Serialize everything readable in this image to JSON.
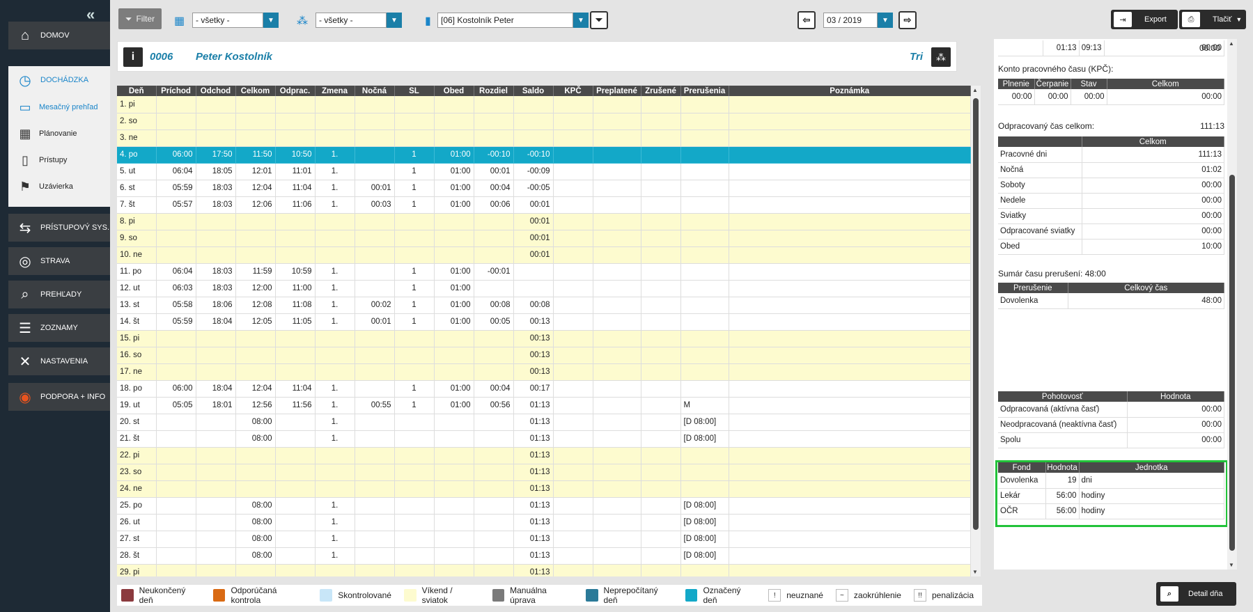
{
  "sidebar": {
    "items": [
      {
        "label": "DOMOV",
        "icon": "home-icon"
      },
      {
        "label": "DOCHÁDZKA",
        "icon": "clock-icon"
      },
      {
        "label": "PRÍSTUPOVÝ SYS.",
        "icon": "handshake-icon"
      },
      {
        "label": "STRAVA",
        "icon": "plate-icon"
      },
      {
        "label": "PREHĽADY",
        "icon": "book-search-icon"
      },
      {
        "label": "ZOZNAMY",
        "icon": "list-icon"
      },
      {
        "label": "NASTAVENIA",
        "icon": "tools-icon"
      },
      {
        "label": "PODPORA + INFO",
        "icon": "lifebuoy-icon"
      }
    ],
    "subitems": [
      {
        "label": "Mesačný prehľad",
        "icon": "book-icon"
      },
      {
        "label": "Plánovanie",
        "icon": "calendar-icon"
      },
      {
        "label": "Prístupy",
        "icon": "door-icon"
      },
      {
        "label": "Uzávierka",
        "icon": "flag-icon"
      }
    ]
  },
  "toolbar": {
    "filter_label": "Filter",
    "select1": "- všetky -",
    "select2": "- všetky -",
    "employee": "[06] Kostolník Peter",
    "month": "03 / 2019",
    "export_label": "Export",
    "print_label": "Tlačiť"
  },
  "header": {
    "id": "0006",
    "name": "Peter Kostolník",
    "shift": "Tri"
  },
  "table": {
    "columns": [
      "Deň",
      "Príchod",
      "Odchod",
      "Celkom",
      "Odprac.",
      "Zmena",
      "Nočná",
      "SL",
      "Obed",
      "Rozdiel",
      "Saldo",
      "KPČ",
      "Preplatené",
      "Zrušené",
      "Prerušenia",
      "Poznámka"
    ],
    "rows": [
      {
        "t": "wk",
        "c": [
          "1. pi",
          "",
          "",
          "",
          "",
          "",
          "",
          "",
          "",
          "",
          "",
          "",
          "",
          "",
          "",
          ""
        ]
      },
      {
        "t": "wk",
        "c": [
          "2. so",
          "",
          "",
          "",
          "",
          "",
          "",
          "",
          "",
          "",
          "",
          "",
          "",
          "",
          "",
          ""
        ]
      },
      {
        "t": "wk",
        "c": [
          "3. ne",
          "",
          "",
          "",
          "",
          "",
          "",
          "",
          "",
          "",
          "",
          "",
          "",
          "",
          "",
          ""
        ]
      },
      {
        "t": "hl",
        "c": [
          "4. po",
          "06:00",
          "17:50",
          "11:50",
          "10:50",
          "1.",
          "",
          "1",
          "01:00",
          "-00:10",
          "-00:10",
          "",
          "",
          "",
          "",
          ""
        ]
      },
      {
        "t": "n",
        "c": [
          "5. ut",
          "06:04",
          "18:05",
          "12:01",
          "11:01",
          "1.",
          "",
          "1",
          "01:00",
          "00:01",
          "-00:09",
          "",
          "",
          "",
          "",
          ""
        ]
      },
      {
        "t": "n",
        "c": [
          "6. st",
          "05:59",
          "18:03",
          "12:04",
          "11:04",
          "1.",
          "00:01",
          "1",
          "01:00",
          "00:04",
          "-00:05",
          "",
          "",
          "",
          "",
          ""
        ]
      },
      {
        "t": "n",
        "c": [
          "7. št",
          "05:57",
          "18:03",
          "12:06",
          "11:06",
          "1.",
          "00:03",
          "1",
          "01:00",
          "00:06",
          "00:01",
          "",
          "",
          "",
          "",
          ""
        ]
      },
      {
        "t": "wk",
        "c": [
          "8. pi",
          "",
          "",
          "",
          "",
          "",
          "",
          "",
          "",
          "",
          "00:01",
          "",
          "",
          "",
          "",
          ""
        ]
      },
      {
        "t": "wk",
        "c": [
          "9. so",
          "",
          "",
          "",
          "",
          "",
          "",
          "",
          "",
          "",
          "00:01",
          "",
          "",
          "",
          "",
          ""
        ]
      },
      {
        "t": "wk",
        "c": [
          "10. ne",
          "",
          "",
          "",
          "",
          "",
          "",
          "",
          "",
          "",
          "00:01",
          "",
          "",
          "",
          "",
          ""
        ]
      },
      {
        "t": "n",
        "c": [
          "11. po",
          "06:04",
          "18:03",
          "11:59",
          "10:59",
          "1.",
          "",
          "1",
          "01:00",
          "-00:01",
          "",
          "",
          "",
          "",
          "",
          ""
        ]
      },
      {
        "t": "n",
        "c": [
          "12. ut",
          "06:03",
          "18:03",
          "12:00",
          "11:00",
          "1.",
          "",
          "1",
          "01:00",
          "",
          "",
          "",
          "",
          "",
          "",
          ""
        ]
      },
      {
        "t": "n",
        "c": [
          "13. st",
          "05:58",
          "18:06",
          "12:08",
          "11:08",
          "1.",
          "00:02",
          "1",
          "01:00",
          "00:08",
          "00:08",
          "",
          "",
          "",
          "",
          ""
        ]
      },
      {
        "t": "n",
        "c": [
          "14. št",
          "05:59",
          "18:04",
          "12:05",
          "11:05",
          "1.",
          "00:01",
          "1",
          "01:00",
          "00:05",
          "00:13",
          "",
          "",
          "",
          "",
          ""
        ]
      },
      {
        "t": "wk",
        "c": [
          "15. pi",
          "",
          "",
          "",
          "",
          "",
          "",
          "",
          "",
          "",
          "00:13",
          "",
          "",
          "",
          "",
          ""
        ]
      },
      {
        "t": "wk",
        "c": [
          "16. so",
          "",
          "",
          "",
          "",
          "",
          "",
          "",
          "",
          "",
          "00:13",
          "",
          "",
          "",
          "",
          ""
        ]
      },
      {
        "t": "wk",
        "c": [
          "17. ne",
          "",
          "",
          "",
          "",
          "",
          "",
          "",
          "",
          "",
          "00:13",
          "",
          "",
          "",
          "",
          ""
        ]
      },
      {
        "t": "n",
        "c": [
          "18. po",
          "06:00",
          "18:04",
          "12:04",
          "11:04",
          "1.",
          "",
          "1",
          "01:00",
          "00:04",
          "00:17",
          "",
          "",
          "",
          "",
          ""
        ]
      },
      {
        "t": "n",
        "c": [
          "19. ut",
          "05:05",
          "18:01",
          "12:56",
          "11:56",
          "1.",
          "00:55",
          "1",
          "01:00",
          "00:56",
          "01:13",
          "",
          "",
          "",
          "M",
          ""
        ]
      },
      {
        "t": "n",
        "c": [
          "20. st",
          "",
          "",
          "08:00",
          "",
          "1.",
          "",
          "",
          "",
          "",
          "01:13",
          "",
          "",
          "",
          "[D 08:00]",
          ""
        ]
      },
      {
        "t": "n",
        "c": [
          "21. št",
          "",
          "",
          "08:00",
          "",
          "1.",
          "",
          "",
          "",
          "",
          "01:13",
          "",
          "",
          "",
          "[D 08:00]",
          ""
        ]
      },
      {
        "t": "wk",
        "c": [
          "22. pi",
          "",
          "",
          "",
          "",
          "",
          "",
          "",
          "",
          "",
          "01:13",
          "",
          "",
          "",
          "",
          ""
        ]
      },
      {
        "t": "wk",
        "c": [
          "23. so",
          "",
          "",
          "",
          "",
          "",
          "",
          "",
          "",
          "",
          "01:13",
          "",
          "",
          "",
          "",
          ""
        ]
      },
      {
        "t": "wk",
        "c": [
          "24. ne",
          "",
          "",
          "",
          "",
          "",
          "",
          "",
          "",
          "",
          "01:13",
          "",
          "",
          "",
          "",
          ""
        ]
      },
      {
        "t": "n",
        "c": [
          "25. po",
          "",
          "",
          "08:00",
          "",
          "1.",
          "",
          "",
          "",
          "",
          "01:13",
          "",
          "",
          "",
          "[D 08:00]",
          ""
        ]
      },
      {
        "t": "n",
        "c": [
          "26. ut",
          "",
          "",
          "08:00",
          "",
          "1.",
          "",
          "",
          "",
          "",
          "01:13",
          "",
          "",
          "",
          "[D 08:00]",
          ""
        ]
      },
      {
        "t": "n",
        "c": [
          "27. st",
          "",
          "",
          "08:00",
          "",
          "1.",
          "",
          "",
          "",
          "",
          "01:13",
          "",
          "",
          "",
          "[D 08:00]",
          ""
        ]
      },
      {
        "t": "n",
        "c": [
          "28. št",
          "",
          "",
          "08:00",
          "",
          "1.",
          "",
          "",
          "",
          "",
          "01:13",
          "",
          "",
          "",
          "[D 08:00]",
          ""
        ]
      },
      {
        "t": "wk",
        "c": [
          "29. pi",
          "",
          "",
          "",
          "",
          "",
          "",
          "",
          "",
          "",
          "01:13",
          "",
          "",
          "",
          "",
          ""
        ]
      }
    ]
  },
  "legend": [
    {
      "label": "Neukončený deň",
      "color": "#8b3a3e"
    },
    {
      "label": "Odporúčaná kontrola",
      "color": "#d96a13"
    },
    {
      "label": "Skontrolované",
      "color": "#c8e6f8"
    },
    {
      "label": "Víkend / sviatok",
      "color": "#fdfbcf"
    },
    {
      "label": "Manuálna úprava",
      "color": "#7a7a7a"
    },
    {
      "label": "Neprepočítaný deň",
      "color": "#2b7a98"
    },
    {
      "label": "Označený deň",
      "color": "#13a8c8"
    },
    {
      "label": "neuznané",
      "symbol": "!"
    },
    {
      "label": "zaokrúhlenie",
      "symbol": "~"
    },
    {
      "label": "penalizácia",
      "symbol": "!!"
    }
  ],
  "right": {
    "top_row": [
      "01:13",
      "09:13",
      "00:00",
      "00:00"
    ],
    "kpc_title": "Konto pracovného času (KPČ):",
    "kpc_cols": [
      "Plnenie",
      "Čerpanie",
      "Stav",
      "Celkom"
    ],
    "kpc_vals": [
      "00:00",
      "00:00",
      "00:00",
      "00:00"
    ],
    "odprac_label": "Odpracovaný čas celkom:",
    "odprac_val": "111:13",
    "celkom_header": "Celkom",
    "celkom_rows": [
      [
        "Pracovné dni",
        "111:13"
      ],
      [
        "Nočná",
        "01:02"
      ],
      [
        "Soboty",
        "00:00"
      ],
      [
        "Nedele",
        "00:00"
      ],
      [
        "Sviatky",
        "00:00"
      ],
      [
        "Odpracované sviatky",
        "00:00"
      ],
      [
        "Obed",
        "10:00"
      ]
    ],
    "prerusenie_label": "Sumár času prerušení:",
    "prerusenie_val": "48:00",
    "prer_cols": [
      "Prerušenie",
      "Celkový čas"
    ],
    "prer_rows": [
      [
        "Dovolenka",
        "48:00"
      ]
    ],
    "poh_cols": [
      "Pohotovosť",
      "Hodnota"
    ],
    "poh_rows": [
      [
        "Odpracovaná (aktívna časť)",
        "00:00"
      ],
      [
        "Neodpracovaná (neaktívna časť)",
        "00:00"
      ],
      [
        "Spolu",
        "00:00"
      ]
    ],
    "fond_cols": [
      "Fond",
      "Hodnota",
      "Jednotka"
    ],
    "fond_rows": [
      [
        "Dovolenka",
        "19",
        "dni"
      ],
      [
        "Lekár",
        "56:00",
        "hodiny"
      ],
      [
        "OČR",
        "56:00",
        "hodiny"
      ]
    ]
  },
  "detail_label": "Detail dňa"
}
